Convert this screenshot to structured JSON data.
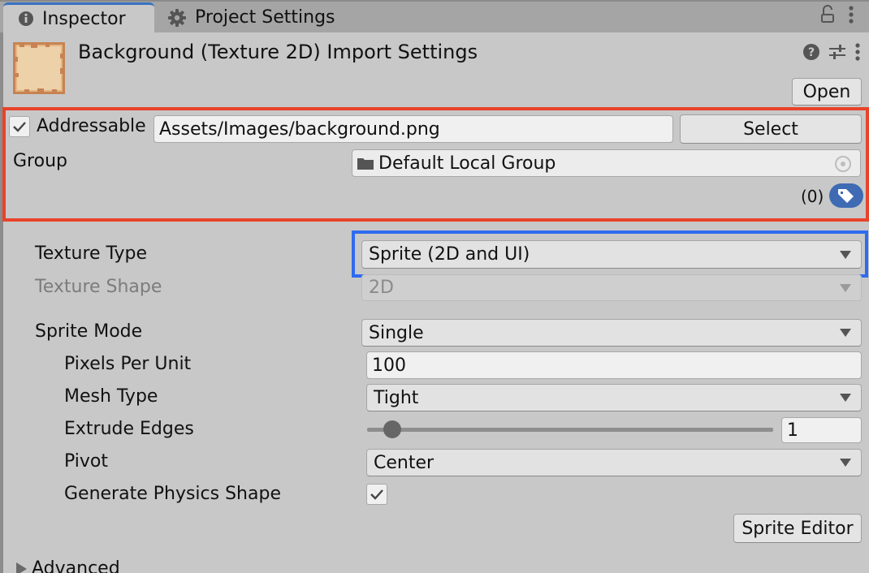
{
  "tabs": [
    {
      "label": "Inspector",
      "icon": "info-icon",
      "active": true
    },
    {
      "label": "Project Settings",
      "icon": "gear-icon",
      "active": false
    }
  ],
  "tab_actions": [
    "lock-icon",
    "kebab-menu-icon"
  ],
  "header": {
    "title": "Background (Texture 2D) Import Settings",
    "actions": [
      "help-icon",
      "preset-sliders-icon",
      "kebab-menu-icon"
    ],
    "open_label": "Open"
  },
  "addressables": {
    "enabled": true,
    "label": "Addressable",
    "address": "Assets/Images/background.png",
    "select_label": "Select",
    "group_label": "Group",
    "group_value": "Default Local Group",
    "label_count": "(0)",
    "highlight_color": "#e8432b"
  },
  "texture_type": {
    "label": "Texture Type",
    "value": "Sprite (2D and UI)",
    "highlight_color": "#2f6bf0"
  },
  "texture_shape": {
    "label": "Texture Shape",
    "value": "2D",
    "disabled": true
  },
  "sprite_mode": {
    "label": "Sprite Mode",
    "value": "Single"
  },
  "pixels_per_unit": {
    "label": "Pixels Per Unit",
    "value": "100"
  },
  "mesh_type": {
    "label": "Mesh Type",
    "value": "Tight"
  },
  "extrude_edges": {
    "label": "Extrude Edges",
    "value": "1",
    "min": 0,
    "max": 32,
    "slider_value": 1
  },
  "pivot": {
    "label": "Pivot",
    "value": "Center"
  },
  "generate_physics_shape": {
    "label": "Generate Physics Shape",
    "checked": true
  },
  "sprite_editor_label": "Sprite Editor",
  "advanced_label": "Advanced"
}
